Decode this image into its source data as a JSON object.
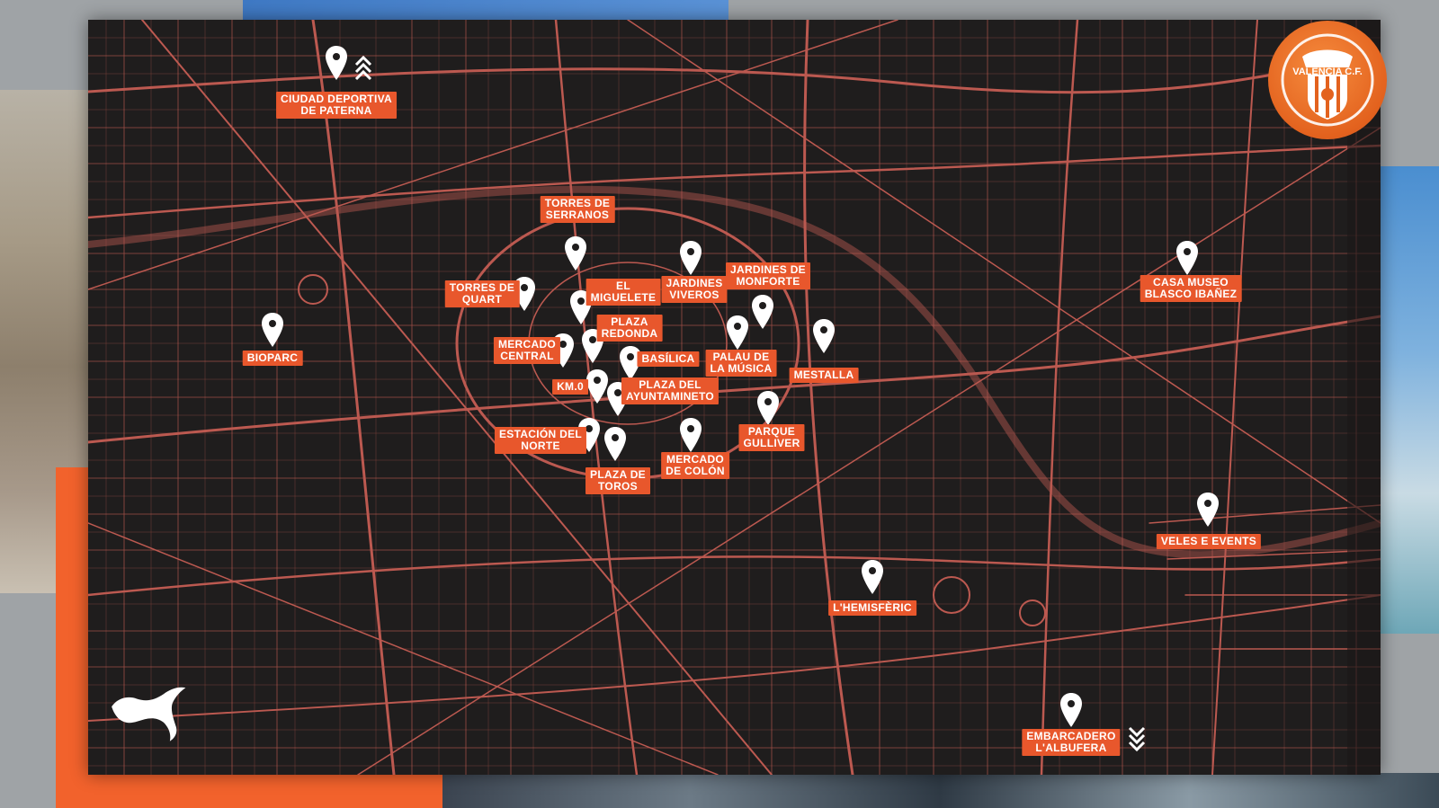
{
  "map": {
    "club_crest_text": "VALENCIA C.F.",
    "colors": {
      "accent": "#e8572c",
      "map_background": "#1f1d1d",
      "streets": "#d8645a",
      "pin": "#ffffff"
    },
    "locations": [
      {
        "name": "CIUDAD DEPORTIVA\nDE PATERNA"
      },
      {
        "name": "TORRES DE\nSERRANOS"
      },
      {
        "name": "TORRES DE\nQUART"
      },
      {
        "name": "EL\nMIGUELETE"
      },
      {
        "name": "JARDINES\nVIVEROS"
      },
      {
        "name": "JARDINES DE\nMONFORTE"
      },
      {
        "name": "CASA MUSEO\nBLASCO IBAÑEZ"
      },
      {
        "name": "BIOPARC"
      },
      {
        "name": "PLAZA\nREDONDA"
      },
      {
        "name": "MERCADO\nCENTRAL"
      },
      {
        "name": "BASÍLICA"
      },
      {
        "name": "PALAU DE\nLA MÚSICA"
      },
      {
        "name": "MESTALLA"
      },
      {
        "name": "KM.0"
      },
      {
        "name": "PLAZA DEL\nAYUNTAMINETO"
      },
      {
        "name": "PARQUE\nGULLIVER"
      },
      {
        "name": "ESTACIÓN DEL\nNORTE"
      },
      {
        "name": "MERCADO\nDE COLÓN"
      },
      {
        "name": "PLAZA DE\nTOROS"
      },
      {
        "name": "VELES E EVENTS"
      },
      {
        "name": "L'HEMISFÈRIC"
      },
      {
        "name": "EMBARCADERO\nL'ALBUFERA"
      }
    ],
    "icons": [
      "map-pin-icon",
      "chevrons-up-icon",
      "chevrons-down-icon",
      "puma-logo-icon",
      "valencia-crest-icon"
    ]
  }
}
